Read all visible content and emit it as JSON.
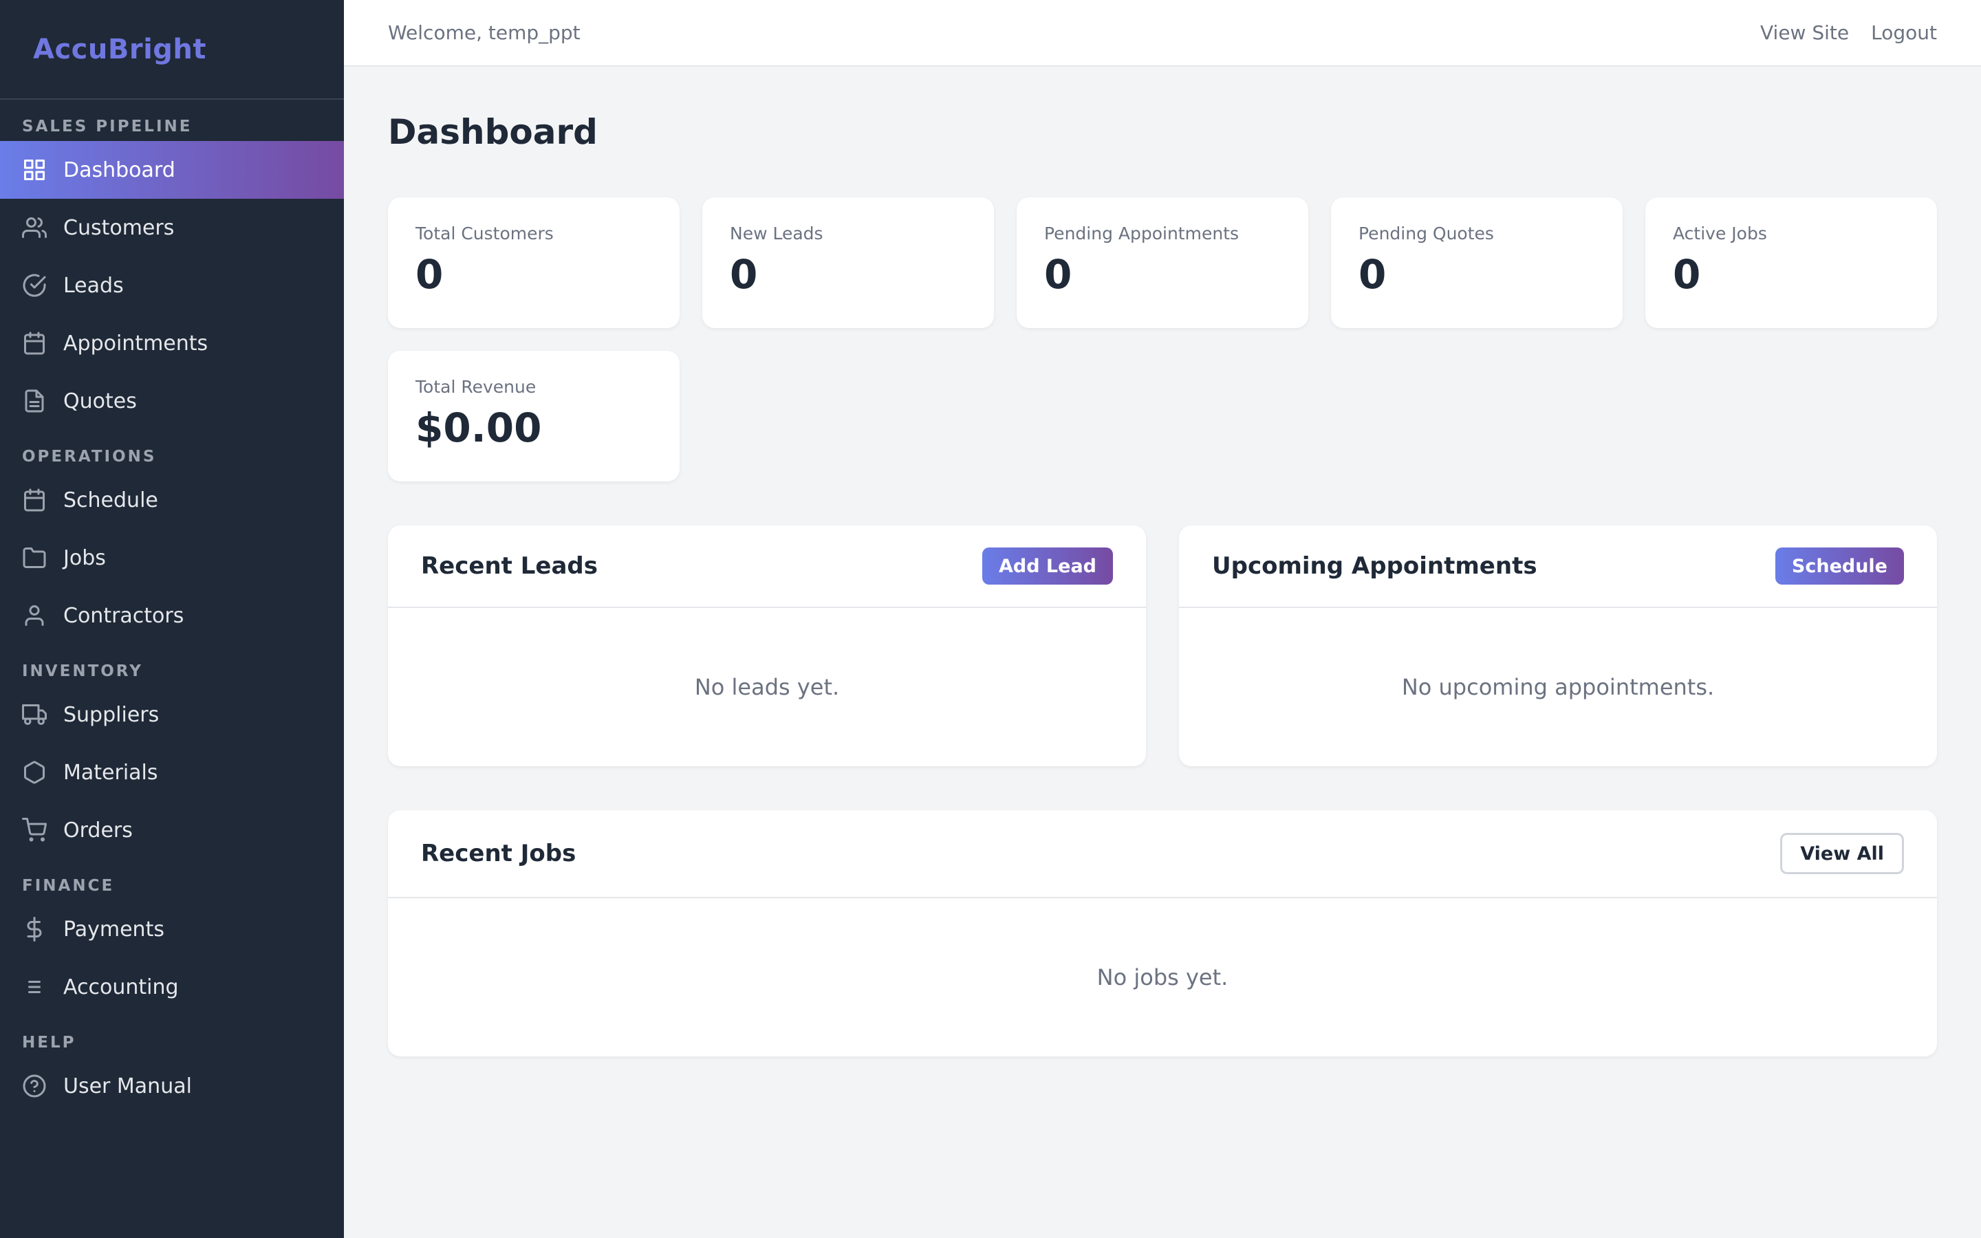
{
  "brand": "AccuBright",
  "sidebar": {
    "sections": [
      {
        "title": "SALES PIPELINE",
        "items": [
          {
            "label": "Dashboard",
            "icon": "grid-icon",
            "active": true
          },
          {
            "label": "Customers",
            "icon": "users-icon"
          },
          {
            "label": "Leads",
            "icon": "check-circle-icon"
          },
          {
            "label": "Appointments",
            "icon": "calendar-icon"
          },
          {
            "label": "Quotes",
            "icon": "document-icon"
          }
        ]
      },
      {
        "title": "OPERATIONS",
        "items": [
          {
            "label": "Schedule",
            "icon": "calendar-icon"
          },
          {
            "label": "Jobs",
            "icon": "folder-icon"
          },
          {
            "label": "Contractors",
            "icon": "user-icon"
          }
        ]
      },
      {
        "title": "INVENTORY",
        "items": [
          {
            "label": "Suppliers",
            "icon": "truck-icon"
          },
          {
            "label": "Materials",
            "icon": "hexagon-icon"
          },
          {
            "label": "Orders",
            "icon": "cart-icon"
          }
        ]
      },
      {
        "title": "FINANCE",
        "items": [
          {
            "label": "Payments",
            "icon": "dollar-icon"
          },
          {
            "label": "Accounting",
            "icon": "list-icon"
          }
        ]
      },
      {
        "title": "HELP",
        "items": [
          {
            "label": "User Manual",
            "icon": "help-circle-icon"
          }
        ]
      }
    ]
  },
  "topbar": {
    "welcome": "Welcome, temp_ppt",
    "view_site": "View Site",
    "logout": "Logout"
  },
  "page_title": "Dashboard",
  "stats": [
    {
      "label": "Total Customers",
      "value": "0"
    },
    {
      "label": "New Leads",
      "value": "0"
    },
    {
      "label": "Pending Appointments",
      "value": "0"
    },
    {
      "label": "Pending Quotes",
      "value": "0"
    },
    {
      "label": "Active Jobs",
      "value": "0"
    },
    {
      "label": "Total Revenue",
      "value": "$0.00"
    }
  ],
  "recent_leads": {
    "title": "Recent Leads",
    "button": "Add Lead",
    "empty": "No leads yet."
  },
  "upcoming_appointments": {
    "title": "Upcoming Appointments",
    "button": "Schedule",
    "empty": "No upcoming appointments."
  },
  "recent_jobs": {
    "title": "Recent Jobs",
    "button": "View All",
    "empty": "No jobs yet."
  },
  "colors": {
    "sidebar_bg": "#1f2937",
    "accent_start": "#6a7de8",
    "accent_end": "#764ba2",
    "brand": "#7077e0",
    "page_bg": "#f3f4f6"
  }
}
